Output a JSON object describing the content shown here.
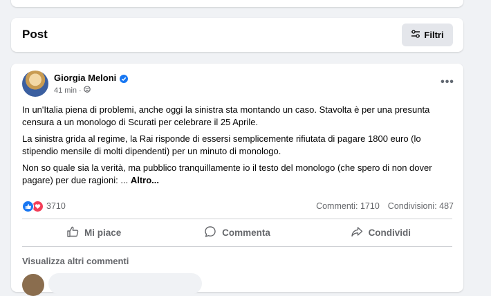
{
  "post_section": {
    "title": "Post",
    "filter_label": "Filtri"
  },
  "post": {
    "author": "Giorgia Meloni",
    "time": "41 min",
    "separator": "·",
    "more_icon": "•••",
    "paragraphs": [
      "In un'Italia piena di problemi, anche oggi la sinistra sta montando un caso. Stavolta è per una presunta censura a un monologo di Scurati per celebrare il 25 Aprile.",
      "La sinistra grida al regime, la Rai risponde di essersi semplicemente rifiutata di pagare 1800 euro (lo stipendio mensile di molti dipendenti) per un minuto di monologo.",
      "Non so quale sia la verità, ma pubblico tranquillamente io il testo del monologo (che spero di non dover pagare) per due ragioni: ... "
    ],
    "see_more": "Altro...",
    "reaction_count": "3710",
    "comments_count": "Commenti: 1710",
    "shares_count": "Condivisioni: 487",
    "actions": {
      "like": "Mi piace",
      "comment": "Commenta",
      "share": "Condividi"
    },
    "more_comments": "Visualizza altri commenti"
  },
  "colors": {
    "like_blue": "#1877f2",
    "love_red": "#f33e58",
    "secondary_text": "#65676b"
  }
}
